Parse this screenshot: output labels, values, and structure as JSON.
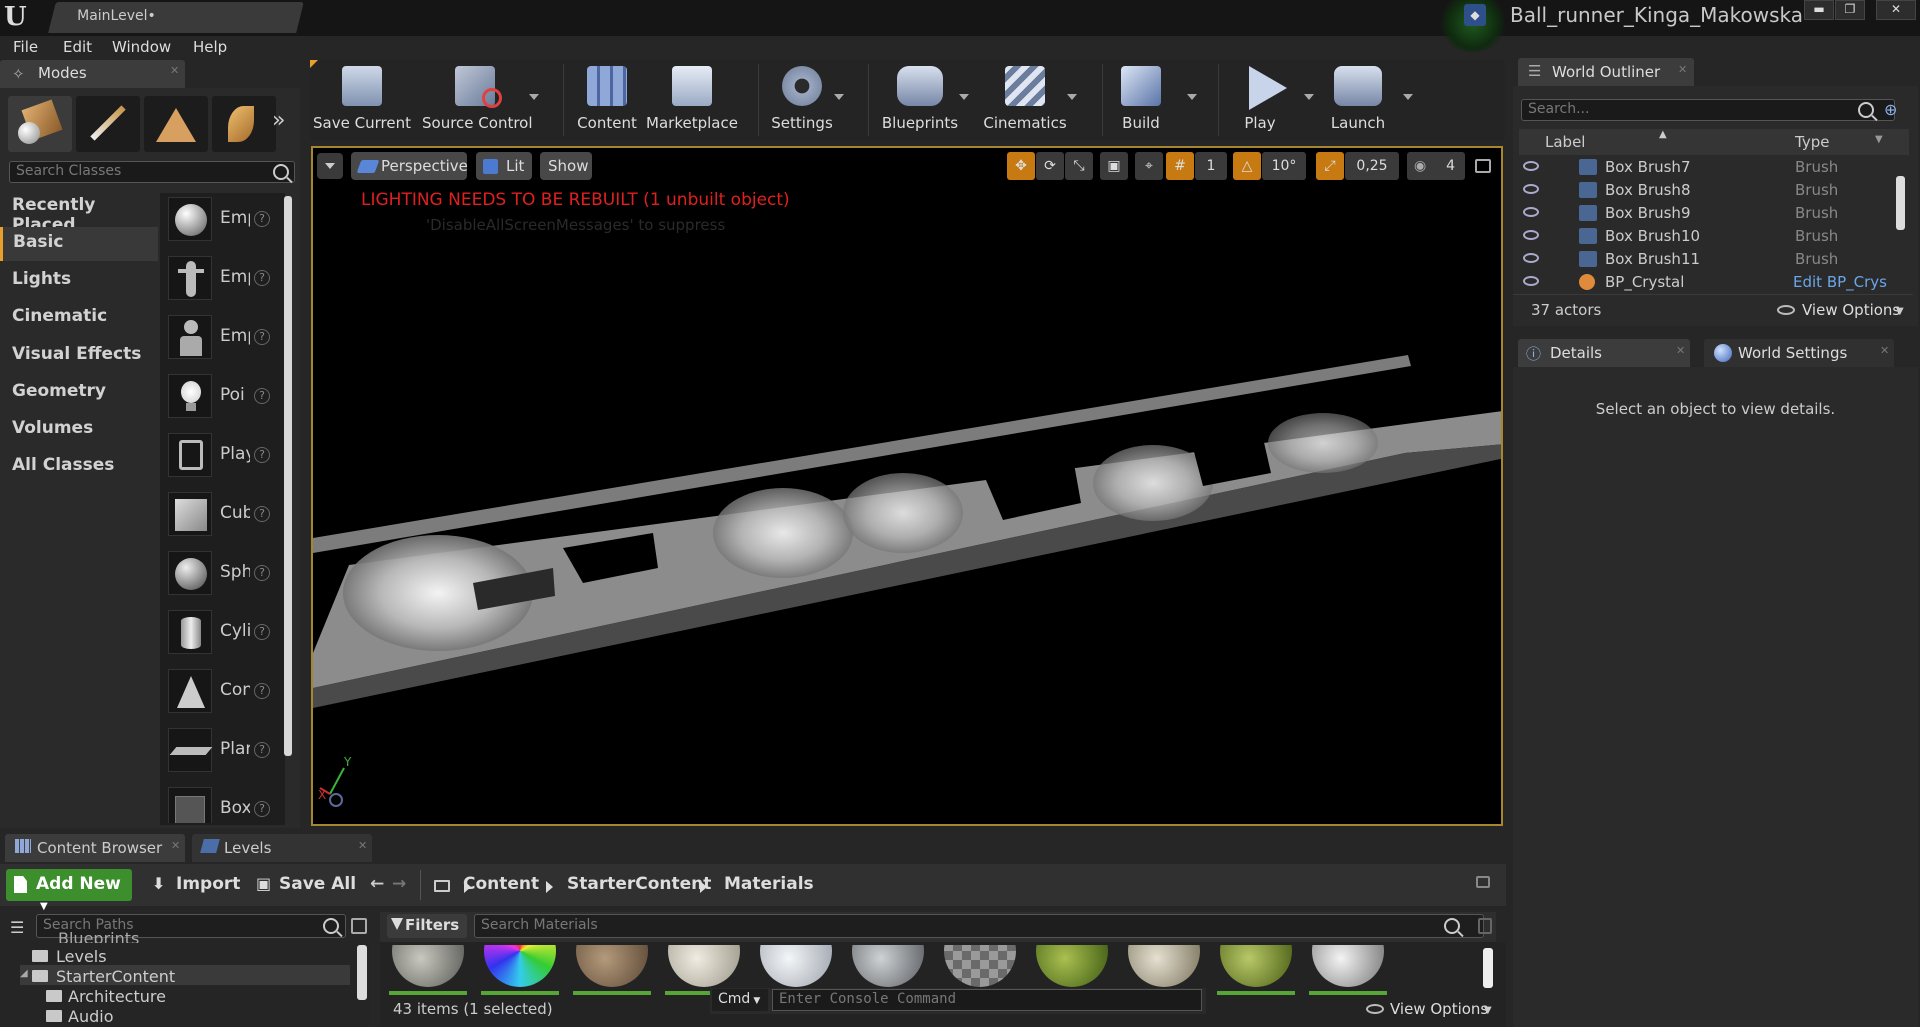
{
  "window": {
    "tab_title": "MainLevel•",
    "project_name": "Ball_runner_Kinga_Makowska",
    "controls": [
      "▬",
      "❐",
      "✕"
    ]
  },
  "menu": [
    "File",
    "Edit",
    "Window",
    "Help"
  ],
  "modes": {
    "tab_label": "Modes",
    "search_placeholder": "Search Classes",
    "categories": [
      "Recently Placed",
      "Basic",
      "Lights",
      "Cinematic",
      "Visual Effects",
      "Geometry",
      "Volumes",
      "All Classes"
    ],
    "selected_category": "Basic",
    "place_items": [
      "Emp",
      "Emp",
      "Emp",
      "Poi",
      "Play",
      "Cub",
      "Sph",
      "Cyli",
      "Con",
      "Plar",
      "Box"
    ]
  },
  "toolbar": {
    "buttons": [
      "Save Current",
      "Source Control",
      "Content",
      "Marketplace",
      "Settings",
      "Blueprints",
      "Cinematics",
      "Build",
      "Play",
      "Launch"
    ]
  },
  "viewport": {
    "perspective": "Perspective",
    "lit": "Lit",
    "show": "Show",
    "grid_snap": "1",
    "rotation_snap": "10°",
    "scale_snap": "0,25",
    "camera_speed": "4",
    "warning": "LIGHTING NEEDS TO BE REBUILT (1 unbuilt object)",
    "suppress": "'DisableAllScreenMessages' to suppress"
  },
  "outliner": {
    "tab_label": "World Outliner",
    "search_placeholder": "Search...",
    "col_label": "Label",
    "col_type": "Type",
    "rows": [
      {
        "name": "Box Brush7",
        "type": "Brush"
      },
      {
        "name": "Box Brush8",
        "type": "Brush"
      },
      {
        "name": "Box Brush9",
        "type": "Brush"
      },
      {
        "name": "Box Brush10",
        "type": "Brush"
      },
      {
        "name": "Box Brush11",
        "type": "Brush"
      },
      {
        "name": "BP_Crystal",
        "type": "Edit BP_Crys"
      }
    ],
    "actor_count": "37 actors",
    "view_options": "View Options"
  },
  "details": {
    "tab_label": "Details",
    "world_settings_label": "World Settings",
    "empty_message": "Select an object to view details."
  },
  "content_browser": {
    "tab_label": "Content Browser",
    "levels_tab": "Levels",
    "add_new": "Add New",
    "import": "Import",
    "save_all": "Save All",
    "breadcrumb": [
      "Content",
      "StarterContent",
      "Materials"
    ],
    "path_search_placeholder": "Search Paths",
    "tree": [
      "Blueprints",
      "Levels",
      "StarterContent",
      "Architecture",
      "Audio"
    ],
    "filters": "Filters",
    "material_search_placeholder": "Search Materials",
    "items_count": "43 items (1 selected)",
    "cmd_label": "Cmd",
    "console_placeholder": "Enter Console Command",
    "view_options": "View Options"
  },
  "colors": {
    "accent": "#e8a02c",
    "add_new": "#3c8f2c",
    "warning": "#e02020",
    "viewport_border": "#a6862e"
  }
}
